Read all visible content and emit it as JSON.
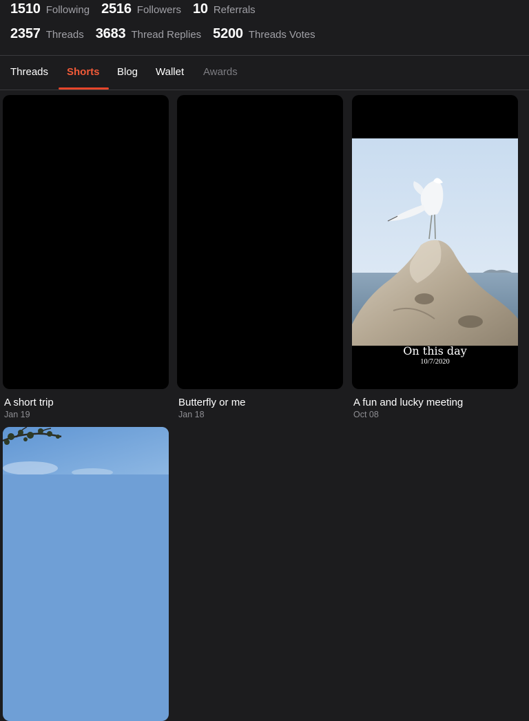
{
  "stats": {
    "row1": [
      {
        "value": "1510",
        "label": "Following"
      },
      {
        "value": "2516",
        "label": "Followers"
      },
      {
        "value": "10",
        "label": "Referrals"
      }
    ],
    "row2": [
      {
        "value": "2357",
        "label": "Threads"
      },
      {
        "value": "3683",
        "label": "Thread Replies"
      },
      {
        "value": "5200",
        "label": "Threads Votes"
      }
    ]
  },
  "tabs": [
    {
      "label": "Threads",
      "state": "normal"
    },
    {
      "label": "Shorts",
      "state": "active"
    },
    {
      "label": "Blog",
      "state": "normal"
    },
    {
      "label": "Wallet",
      "state": "normal"
    },
    {
      "label": "Awards",
      "state": "muted"
    }
  ],
  "shorts": [
    {
      "title": "A short trip",
      "date": "Jan 19"
    },
    {
      "title": "Butterfly or me",
      "date": "Jan 18"
    },
    {
      "title": "A fun and lucky meeting",
      "date": "Oct 08",
      "overlay_title": "On this day",
      "overlay_date": "10/7/2020"
    },
    {
      "title": "",
      "date": ""
    }
  ],
  "colors": {
    "accent": "#f05a38",
    "background": "#1c1c1e",
    "muted_text": "#a0a0a6"
  }
}
